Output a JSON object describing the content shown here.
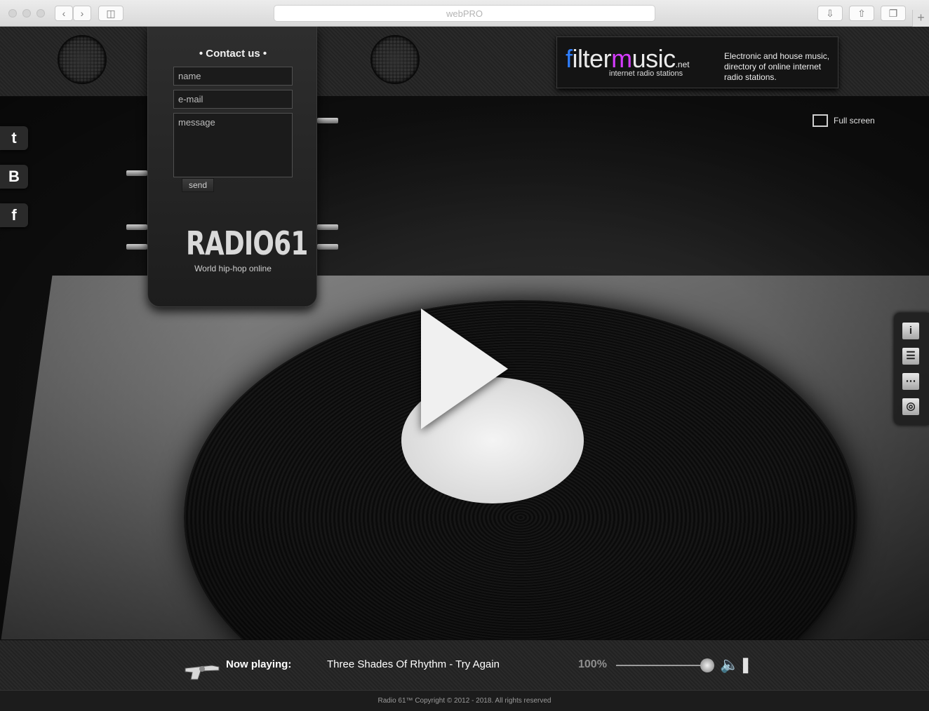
{
  "browser": {
    "address": "webPRO",
    "new_tab_label": "+"
  },
  "contact": {
    "title": "• Contact us •",
    "name_placeholder": "name",
    "email_placeholder": "e-mail",
    "message_placeholder": "message",
    "send_label": "send"
  },
  "logo": {
    "wordmark": "RADIO61",
    "tagline": "World hip-hop online"
  },
  "filtermusic": {
    "brand_filter": "filter",
    "brand_music": "music",
    "brand_net": ".net",
    "subtitle": "internet radio stations",
    "description": "Electronic and house music, directory of online internet radio stations."
  },
  "social": [
    "t",
    "B",
    "f"
  ],
  "fullscreen_label": "Full screen",
  "toolbar": {
    "icons": [
      "info-icon",
      "playlist-icon",
      "chat-icon",
      "record-icon"
    ]
  },
  "player": {
    "now_playing_label": "Now playing:",
    "track": "Three Shades Of Rhythm - Try Again",
    "volume_label": "100%",
    "volume_level": 1.0
  },
  "footer": {
    "copyright": "Radio 61™ Copyright © 2012 - 2018. All rights reserved"
  },
  "colors": {
    "filter_letters": [
      "#2f7fff",
      "#1fb8ff",
      "#7ad03a",
      "#ffcc00",
      "#ff6a00",
      "#ff2d2d"
    ],
    "music_m": "#d63cff"
  }
}
